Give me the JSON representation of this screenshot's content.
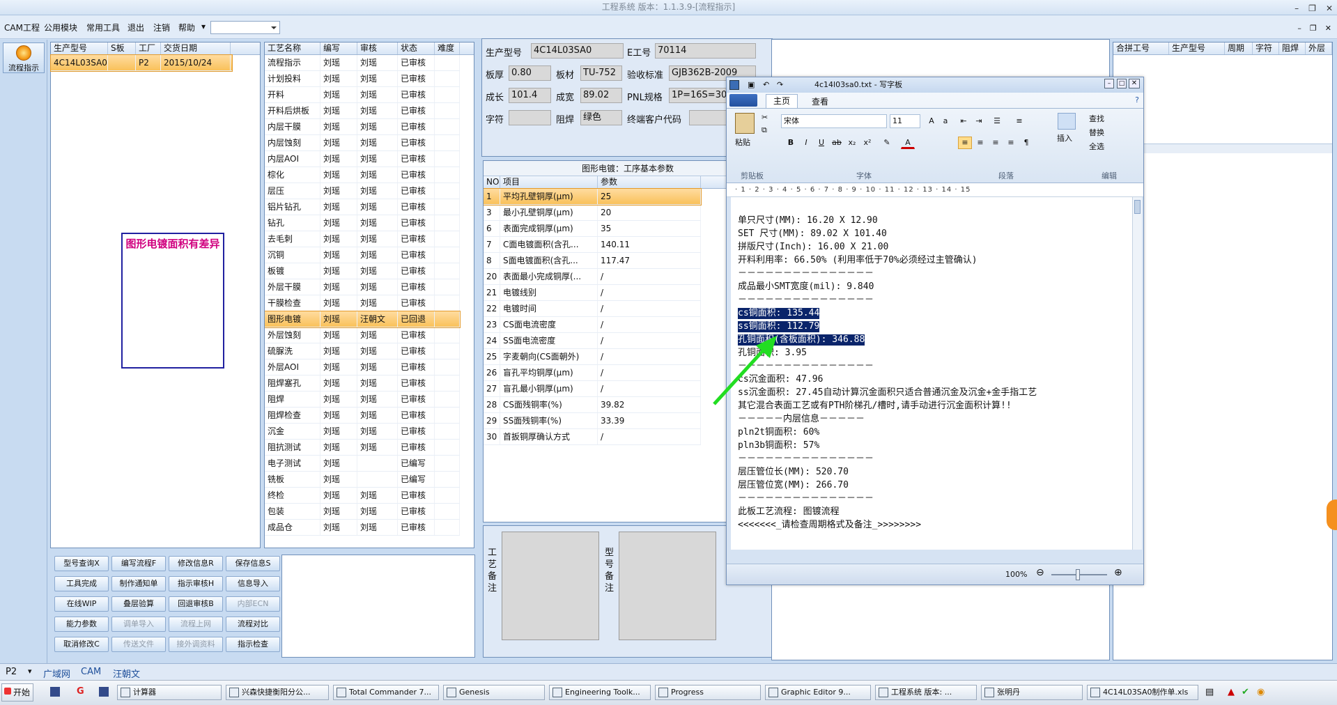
{
  "window_title": "工程系统  版本：1.1.3.9-[流程指示]",
  "menu": [
    "CAM工程",
    "公用模块",
    "常用工具",
    "退出",
    "注销",
    "帮助"
  ],
  "nav_button": "流程指示",
  "order_grid": {
    "headers": [
      "生产型号",
      "S板",
      "工厂",
      "交货日期"
    ],
    "rows": [
      [
        "4C14L03SA0",
        "",
        "P2",
        "2015/10/24"
      ]
    ]
  },
  "warning_text": "图形电镀面积有差异",
  "process_grid": {
    "headers": [
      "工艺名称",
      "编写",
      "审核",
      "状态",
      "难度"
    ],
    "rows": [
      [
        "流程指示",
        "刘瑶",
        "刘瑶",
        "已审核",
        ""
      ],
      [
        "计划投料",
        "刘瑶",
        "刘瑶",
        "已审核",
        ""
      ],
      [
        "开料",
        "刘瑶",
        "刘瑶",
        "已审核",
        ""
      ],
      [
        "开料后烘板",
        "刘瑶",
        "刘瑶",
        "已审核",
        ""
      ],
      [
        "内层干膜",
        "刘瑶",
        "刘瑶",
        "已审核",
        ""
      ],
      [
        "内层蚀刻",
        "刘瑶",
        "刘瑶",
        "已审核",
        ""
      ],
      [
        "内层AOI",
        "刘瑶",
        "刘瑶",
        "已审核",
        ""
      ],
      [
        "棕化",
        "刘瑶",
        "刘瑶",
        "已审核",
        ""
      ],
      [
        "层压",
        "刘瑶",
        "刘瑶",
        "已审核",
        ""
      ],
      [
        "铝片钻孔",
        "刘瑶",
        "刘瑶",
        "已审核",
        ""
      ],
      [
        "钻孔",
        "刘瑶",
        "刘瑶",
        "已审核",
        ""
      ],
      [
        "去毛刺",
        "刘瑶",
        "刘瑶",
        "已审核",
        ""
      ],
      [
        "沉铜",
        "刘瑶",
        "刘瑶",
        "已审核",
        ""
      ],
      [
        "板镀",
        "刘瑶",
        "刘瑶",
        "已审核",
        ""
      ],
      [
        "外层干膜",
        "刘瑶",
        "刘瑶",
        "已审核",
        ""
      ],
      [
        "干膜检查",
        "刘瑶",
        "刘瑶",
        "已审核",
        ""
      ],
      [
        "图形电镀",
        "刘瑶",
        "汪朝文",
        "已回退",
        ""
      ],
      [
        "外层蚀刻",
        "刘瑶",
        "刘瑶",
        "已审核",
        ""
      ],
      [
        "硫脲洗",
        "刘瑶",
        "刘瑶",
        "已审核",
        ""
      ],
      [
        "外层AOI",
        "刘瑶",
        "刘瑶",
        "已审核",
        ""
      ],
      [
        "阻焊塞孔",
        "刘瑶",
        "刘瑶",
        "已审核",
        ""
      ],
      [
        "阻焊",
        "刘瑶",
        "刘瑶",
        "已审核",
        ""
      ],
      [
        "阻焊检查",
        "刘瑶",
        "刘瑶",
        "已审核",
        ""
      ],
      [
        "沉金",
        "刘瑶",
        "刘瑶",
        "已审核",
        ""
      ],
      [
        "阻抗测试",
        "刘瑶",
        "刘瑶",
        "已审核",
        ""
      ],
      [
        "电子测试",
        "刘瑶",
        "",
        "已编写",
        ""
      ],
      [
        "铣板",
        "刘瑶",
        "",
        "已编写",
        ""
      ],
      [
        "终检",
        "刘瑶",
        "刘瑶",
        "已审核",
        ""
      ],
      [
        "包装",
        "刘瑶",
        "刘瑶",
        "已审核",
        ""
      ],
      [
        "成品仓",
        "刘瑶",
        "刘瑶",
        "已审核",
        ""
      ]
    ]
  },
  "buttons": [
    [
      "型号查询X",
      "编写流程F",
      "修改信息R",
      "保存信息S"
    ],
    [
      "工具完成",
      "制作通知单",
      "指示审核H",
      "信息导入"
    ],
    [
      "在线WIP",
      "叠层验算",
      "回退审核B",
      "内部ECN"
    ],
    [
      "能力参数",
      "调单导入",
      "流程上网",
      "流程对比"
    ],
    [
      "取消修改C",
      "传送文件",
      "接外调资料",
      "指示检查"
    ]
  ],
  "info": {
    "l_model": "生产型号",
    "v_model": "4C14L03SA0",
    "l_eno": "E工号",
    "v_eno": "70114",
    "l_thick": "板厚",
    "v_thick": "0.80",
    "l_mat": "板材",
    "v_mat": "TU-752",
    "l_std": "验收标准",
    "v_std": "GJB362B-2009",
    "l_len": "成长",
    "v_len": "101.4",
    "l_wid": "成宽",
    "v_wid": "89.02",
    "l_pnl": "PNL规格",
    "v_pnl": "1P=16S=30",
    "l_char": "字符",
    "v_char": "",
    "l_mask": "阻焊",
    "v_mask": "绿色",
    "l_cust": "终端客户代码",
    "v_cust": ""
  },
  "param_title": "图形电镀：工序基本参数",
  "param_grid": {
    "headers": [
      "NO",
      "项目",
      "参数"
    ],
    "rows": [
      [
        "1",
        "平均孔壁铜厚(μm)",
        "25"
      ],
      [
        "3",
        "最小孔壁铜厚(μm)",
        "20"
      ],
      [
        "6",
        "表面完成铜厚(μm)",
        "35"
      ],
      [
        "7",
        "C面电镀面积(含孔...",
        "140.11"
      ],
      [
        "8",
        "S面电镀面积(含孔...",
        "117.47"
      ],
      [
        "20",
        "表面最小完成铜厚(...",
        "/"
      ],
      [
        "21",
        "电镀线别",
        "/"
      ],
      [
        "22",
        "电镀时间",
        "/"
      ],
      [
        "23",
        "CS面电流密度",
        "/"
      ],
      [
        "24",
        "SS面电流密度",
        "/"
      ],
      [
        "25",
        "字麦朝向(CS面朝外)",
        "/"
      ],
      [
        "26",
        "盲孔平均铜厚(μm)",
        "/"
      ],
      [
        "27",
        "盲孔最小铜厚(μm)",
        "/"
      ],
      [
        "28",
        "CS面残铜率(%)",
        "39.82"
      ],
      [
        "29",
        "SS面残铜率(%)",
        "33.39"
      ],
      [
        "30",
        "首扳铜厚确认方式",
        "/"
      ]
    ]
  },
  "remark_labels": {
    "process": "工艺备注",
    "model": "型号备注"
  },
  "right_grid_headers": [
    "合拼工号",
    "生产型号",
    "周期",
    "字符",
    "阻焊",
    "外层"
  ],
  "wordpad": {
    "title": "4c14l03sa0.txt - 写字板",
    "tabs": [
      "主页",
      "查看"
    ],
    "font_name": "宋体",
    "font_size": "11",
    "groups": [
      "剪贴板",
      "字体",
      "段落",
      "编辑"
    ],
    "paste": "粘贴",
    "insert": "插入",
    "find": "查找",
    "replace": "替换",
    "select_all": "全选",
    "ruler": "· 1 · 2 · 3 · 4 · 5 · 6 · 7 · 8 · 9 · 10 · 11 · 12 · 13 · 14 · 15",
    "zoom": "100%",
    "lines": [
      "单只尺寸(MM): 16.20 X 12.90",
      "SET 尺寸(MM): 89.02 X 101.40",
      "拼版尺寸(Inch): 16.00 X 21.00",
      "开料利用率: 66.50% (利用率低于70%必须经过主管确认)",
      "－－－－－－－－－－－－－－－",
      "成品最小SMT宽度(mil): 9.840",
      "－－－－－－－－－－－－－－－",
      "cs铜面积: 135.44",
      "ss铜面积: 112.79",
      "孔铜面积(含板面积): 346.88",
      "孔铜面积: 3.95",
      "－－－－－－－－－－－－－－－",
      "cs沉金面积: 47.96",
      "ss沉金面积: 27.45自动计算沉金面积只适合普通沉金及沉金+金手指工艺",
      "其它混合表面工艺或有PTH阶梯孔/槽时,请手动进行沉金面积计算!!",
      "－－－－－内层信息－－－－－",
      "pln2t铜面积: 60%",
      "pln3b铜面积: 57%",
      "－－－－－－－－－－－－－－－",
      "层压管位长(MM): 520.70",
      "层压管位宽(MM): 266.70",
      "－－－－－－－－－－－－－－－",
      "此板工艺流程: 图镀流程",
      "<<<<<<<_请检查周期格式及备注_>>>>>>>>"
    ]
  },
  "bottom_tabs": [
    "P2",
    "广域网",
    "CAM",
    "汪朝文"
  ],
  "taskbar": {
    "start": "开始",
    "items": [
      "计算器",
      "兴森快捷衡阳分公...",
      "Total Commander 7...",
      "Genesis",
      "Engineering Toolk...",
      "Progress",
      "Graphic Editor 9...",
      "工程系统  版本: ...",
      "张明丹",
      "4C14L03SA0制作单.xls"
    ]
  },
  "colors": {
    "accent": "#0a246a",
    "selected_row": "#f9c15a",
    "warning": "#d0007f",
    "arrow": "#22dd22"
  }
}
